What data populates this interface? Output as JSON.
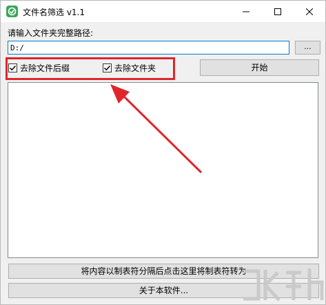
{
  "window": {
    "title": "文件名筛选 v1.1",
    "icon": "app-logo-icon",
    "controls": [
      "minimize-icon",
      "maximize-icon",
      "close-icon"
    ]
  },
  "path": {
    "label": "请输入文件夹完整路径:",
    "value": "D:/",
    "browse_label": "..."
  },
  "options": {
    "remove_suffix": {
      "label": "去除文件后缀",
      "checked": true
    },
    "remove_folder": {
      "label": "去除文件夹",
      "checked": true
    }
  },
  "start_button": "开始",
  "convert_button": "将内容以制表符分隔后点击这里将制表符转为",
  "about_button": "关于本软件...",
  "colors": {
    "highlight": "#e0252b",
    "arrow": "#e0252b",
    "focus_border": "#0078d7"
  }
}
